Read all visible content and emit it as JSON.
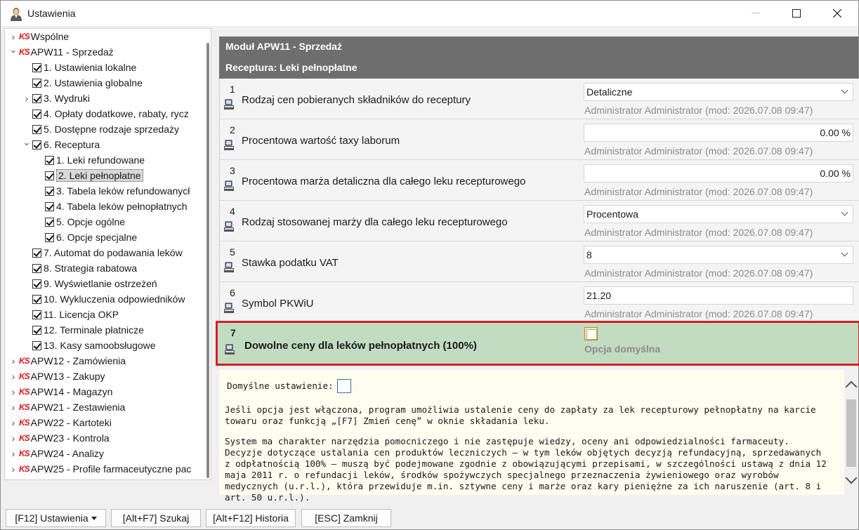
{
  "window": {
    "title": "Ustawienia",
    "app_icon": "user-icon"
  },
  "tree": [
    {
      "label": "Wspólne",
      "level": 0,
      "icon": "ks-logo",
      "expander": "collapsed"
    },
    {
      "label": "APW11 - Sprzedaż",
      "level": 0,
      "icon": "ks-logo",
      "expander": "expanded"
    },
    {
      "label": "1. Ustawienia lokalne",
      "level": 1,
      "icon": "checkbox"
    },
    {
      "label": "2. Ustawienia globalne",
      "level": 1,
      "icon": "checkbox"
    },
    {
      "label": "3. Wydruki",
      "level": 1,
      "icon": "checkbox",
      "expander": "collapsed"
    },
    {
      "label": "4. Opłaty dodatkowe, rabaty, rycz",
      "level": 1,
      "icon": "checkbox"
    },
    {
      "label": "5. Dostępne rodzaje sprzedaży",
      "level": 1,
      "icon": "checkbox"
    },
    {
      "label": "6. Receptura",
      "level": 1,
      "icon": "checkbox",
      "expander": "expanded"
    },
    {
      "label": "1. Leki refundowane",
      "level": 2,
      "icon": "checkbox"
    },
    {
      "label": "2. Leki pełnopłatne",
      "level": 2,
      "icon": "checkbox",
      "selected": true
    },
    {
      "label": "3. Tabela leków refundowanycł",
      "level": 2,
      "icon": "checkbox"
    },
    {
      "label": "4. Tabela leków pełnopłatnych",
      "level": 2,
      "icon": "checkbox"
    },
    {
      "label": "5. Opcje ogólne",
      "level": 2,
      "icon": "checkbox"
    },
    {
      "label": "6. Opcje specjalne",
      "level": 2,
      "icon": "checkbox"
    },
    {
      "label": "7. Automat do podawania leków",
      "level": 1,
      "icon": "checkbox"
    },
    {
      "label": "8. Strategia rabatowa",
      "level": 1,
      "icon": "checkbox"
    },
    {
      "label": "9. Wyświetlanie ostrzeżeń",
      "level": 1,
      "icon": "checkbox"
    },
    {
      "label": "10. Wykluczenia odpowiedników",
      "level": 1,
      "icon": "checkbox"
    },
    {
      "label": "11. Licencja OKP",
      "level": 1,
      "icon": "checkbox"
    },
    {
      "label": "12. Terminale płatnicze",
      "level": 1,
      "icon": "checkbox"
    },
    {
      "label": "13. Kasy samoobsługowe",
      "level": 1,
      "icon": "checkbox"
    },
    {
      "label": "APW12 - Zamówienia",
      "level": 0,
      "icon": "ks-logo",
      "expander": "collapsed"
    },
    {
      "label": "APW13 - Zakupy",
      "level": 0,
      "icon": "ks-logo",
      "expander": "collapsed"
    },
    {
      "label": "APW14 - Magazyn",
      "level": 0,
      "icon": "ks-logo",
      "expander": "collapsed"
    },
    {
      "label": "APW21 - Zestawienia",
      "level": 0,
      "icon": "ks-logo",
      "expander": "collapsed"
    },
    {
      "label": "APW22 - Kartoteki",
      "level": 0,
      "icon": "ks-logo",
      "expander": "collapsed"
    },
    {
      "label": "APW23 - Kontrola",
      "level": 0,
      "icon": "ks-logo",
      "expander": "collapsed"
    },
    {
      "label": "APW24 - Analizy",
      "level": 0,
      "icon": "ks-logo",
      "expander": "collapsed"
    },
    {
      "label": "APW25 - Profile farmaceutyczne pac",
      "level": 0,
      "icon": "ks-logo",
      "expander": "collapsed"
    }
  ],
  "tree_logo_text": "KS",
  "header": {
    "module": "Moduł APW11 - Sprzedaż",
    "section": "Receptura: Leki pełnopłatne"
  },
  "settings": [
    {
      "num": "1",
      "label": "Rodzaj cen pobieranych składników do receptury",
      "value": "Detaliczne",
      "control": "select",
      "meta": "Administrator  Administrator (mod: 2026.07.08 09:47)"
    },
    {
      "num": "2",
      "label": "Procentowa wartość taxy laborum",
      "value": "0.00 %",
      "control": "number",
      "meta": "Administrator  Administrator (mod: 2026.07.08 09:47)"
    },
    {
      "num": "3",
      "label": "Procentowa marża detaliczna dla całego leku recepturowego",
      "value": "0.00 %",
      "control": "number",
      "meta": "Administrator  Administrator (mod: 2026.07.08 09:47)"
    },
    {
      "num": "4",
      "label": "Rodzaj stosowanej marży dla całego leku recepturowego",
      "value": "Procentowa",
      "control": "select",
      "meta": "Administrator  Administrator (mod: 2026.07.08 09:47)"
    },
    {
      "num": "5",
      "label": "Stawka podatku VAT",
      "value": "8",
      "control": "select",
      "meta": "Administrator  Administrator (mod: 2026.07.08 09:47)"
    },
    {
      "num": "6",
      "label": "Symbol PKWiU",
      "value": "21.20",
      "control": "text",
      "meta": "Administrator  Administrator (mod: 2026.07.08 09:47)"
    }
  ],
  "highlighted_setting": {
    "num": "7",
    "label": "Dowolne ceny dla leków pełnopłatnych (100%)",
    "checked": false,
    "meta": "Opcja domyślna"
  },
  "description": {
    "default_label": "Domyślne ustawienie:",
    "default_checked": false,
    "paragraph1": "Jeśli opcja jest włączona, program umożliwia ustalenie ceny do zapłaty za lek recepturowy pełnopłatny na karcie towaru oraz funkcją „[F7] Zmień cenę” w oknie składania leku.",
    "paragraph2": "System ma charakter narzędzia pomocniczego i nie zastępuje wiedzy, oceny ani odpowiedzialności farmaceuty. Decyzje dotyczące ustalania cen produktów leczniczych – w tym leków objętych decyzją refundacyjną, sprzedawanych z odpłatnością 100% – muszą być podejmowane zgodnie z obowiązującymi przepisami, w szczególności ustawą z dnia 12 maja 2011 r. o refundacji leków, środków spożywczych specjalnego przeznaczenia żywieniowego oraz wyrobów medycznych (u.r.l.), która przewiduje m.in. sztywne ceny i marże oraz kary pieniężne za ich naruszenie (art. 8 i art. 50 u.r.l.)."
  },
  "footer": {
    "settings_btn": "[F12] Ustawienia",
    "search_btn": "[Alt+F7] Szukaj",
    "history_btn": "[Alt+F12] Historia",
    "close_btn": "[ESC] Zamknij"
  },
  "colors": {
    "header_bg": "#6e6e6e",
    "highlight_bg": "#c2dcc2",
    "highlight_border": "#d31f25",
    "description_bg": "#fefdf0",
    "ks_logo": "#d8191c"
  }
}
